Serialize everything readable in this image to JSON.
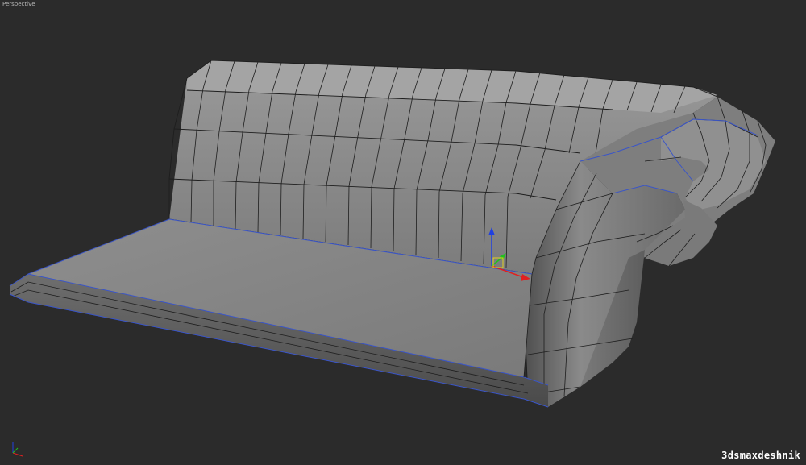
{
  "viewport": {
    "label": "Perspective",
    "background": "#2b2b2b"
  },
  "model": {
    "face_color": "#8a8a8a",
    "wire_color": "#1e1e1e",
    "edge_highlight_color": "#3a55c8"
  },
  "gizmo": {
    "x_color": "#e02020",
    "y_color": "#20c020",
    "z_color": "#2040e0"
  },
  "watermark": {
    "text": "3dsmaxdeshnik"
  }
}
